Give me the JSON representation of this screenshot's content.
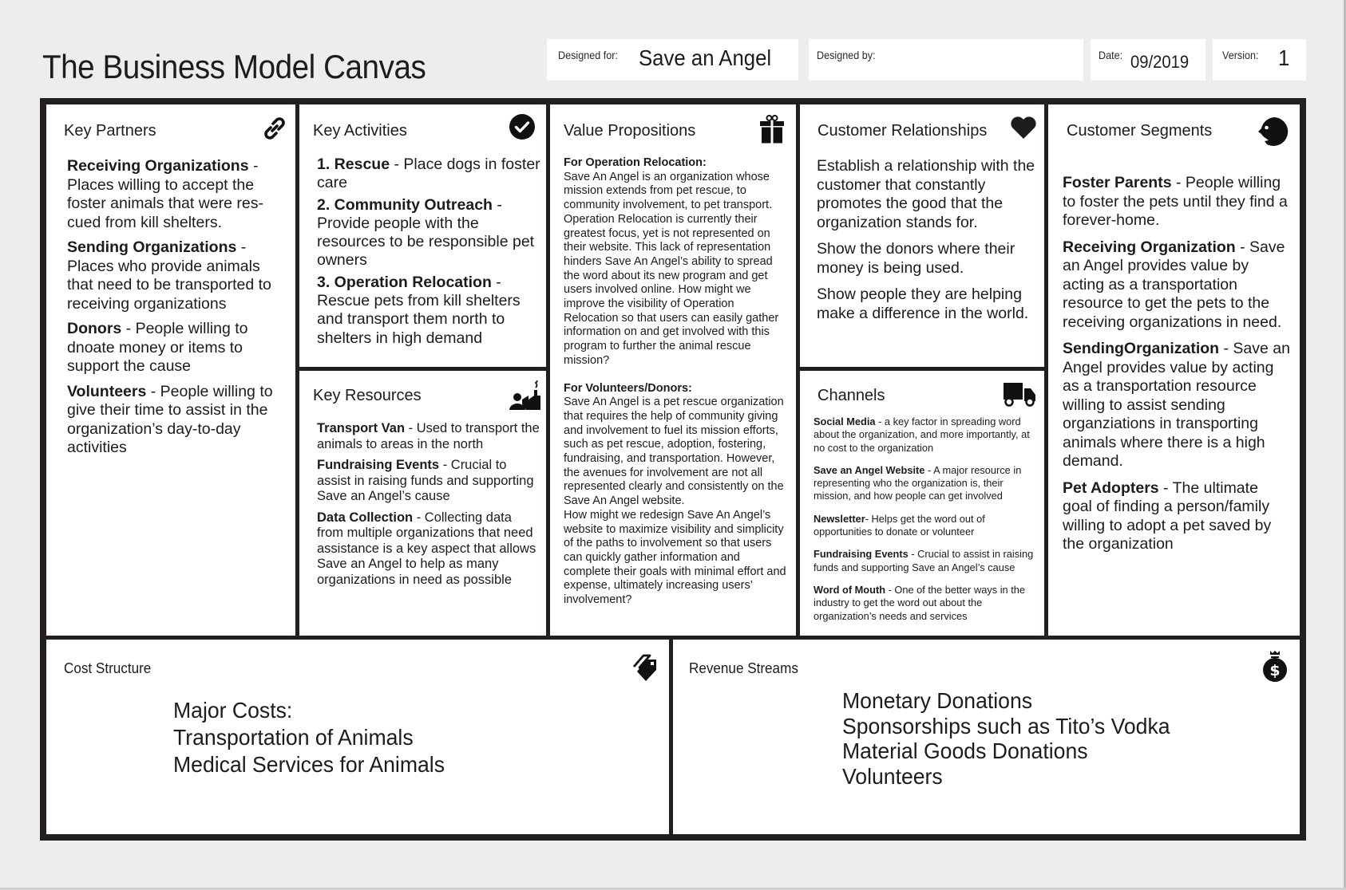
{
  "header": {
    "title": "The Business Model Canvas",
    "designed_for_label": "Designed for:",
    "designed_for_value": "Save an Angel",
    "designed_by_label": "Designed by:",
    "designed_by_value": "",
    "date_label": "Date:",
    "date_value": "09/2019",
    "version_label": "Version:",
    "version_value": "1"
  },
  "key_partners": {
    "title": "Key Partners",
    "icon": "link-icon",
    "items": [
      {
        "term": "Receiving Organizations",
        "desc": " - Places willing to accept the foster animals that were res­cued from kill shelters."
      },
      {
        "term": "Sending Organizations",
        "desc": " - Places who provide animals that need to be transported to receiving organizations"
      },
      {
        "term": "Donors",
        "desc": " - People willing to dnoate money or items to support the cause"
      },
      {
        "term": "Volunteers",
        "desc": " - People willing to give their time to assist in the organization’s day-to-day activities"
      }
    ]
  },
  "key_activities": {
    "title": "Key Activities",
    "icon": "check-circle-icon",
    "items": [
      {
        "term": "1. Rescue",
        "desc": " - Place dogs in foster care"
      },
      {
        "term": "2. Community Outreach",
        "desc": " - Provide people with the resources to be responsible pet owners"
      },
      {
        "term": "3. Operation Relocation",
        "desc": " - Rescue pets from kill shelters and transport them north to shelters in high demand"
      }
    ]
  },
  "key_resources": {
    "title": "Key Resources",
    "icon": "worker-factory-icon",
    "items": [
      {
        "term": "Transport Van",
        "desc": " - Used to transport the animals to areas in the north"
      },
      {
        "term": "Fundraising Events",
        "desc": " - Crucial to assist in raising funds and support­ing Save an Angel’s cause"
      },
      {
        "term": "Data Collection",
        "desc": " - Collecting data from multiple organizations that need assistance is a key aspect that allows Save an Angel to help as many organizations in need as possible"
      }
    ]
  },
  "value_propositions": {
    "title": "Value Propositions",
    "icon": "gift-icon",
    "sections": [
      {
        "heading": "For Operation Relocation:",
        "body": "Save An Angel is an organization whose mission extends from pet rescue, to community involvement, to pet trans­port. Operation Relocation is currently their greatest focus, yet is not represent­ed on their website. This lack of repre­sentation hinders Save An Angel’s ability to spread the word about its new program and get users involved online. How might we improve the visibility of Operation Relocation so that users can easily gather information on and get involved with this program to further the animal rescue mission?"
      },
      {
        "heading": "For Volunteers/Donors:",
        "body": "Save An Angel is a pet rescue organiza­tion that requires the help of community giving and involvement to fuel its mission efforts, such as pet rescue, adoption, fostering, fundraising, and transportation. However, the avenues for involvement are not all represented clearly and consistently on the Save An Angel website.",
        "body2": "How might we redesign Save An Angel’s website to maximize visibility and simplicity of the paths to involvement so that users can quickly gather informa­tion and complete their goals with minimal effort and expense, ultimately increasing users’ involvement?"
      }
    ]
  },
  "customer_relationships": {
    "title": "Customer Relationships",
    "icon": "heart-icon",
    "paragraphs": [
      "Establish a relationship with the customer that constantly promotes the good that the organization stands for.",
      "Show the  donors where their money is being used.",
      "Show people they are helping make a difference in the world."
    ]
  },
  "channels": {
    "title": "Channels",
    "icon": "truck-icon",
    "items": [
      {
        "term": "Social Media",
        "desc": " - a key factor in spreading word about the organization, and more importantly, at no cost to the organization"
      },
      {
        "term": "Save an Angel Website",
        "desc": " - A major resource in representing who the organization is, their mission, and how people can get involved"
      },
      {
        "term": "Newsletter",
        "desc": "- Helps get the word out of opportunities to donate or volunteer"
      },
      {
        "term": "Fundraising Events",
        "desc": " - Crucial to assist in raising funds and supporting Save an Angel’s cause"
      },
      {
        "term": "Word of Mouth",
        "desc": " - One of the better ways in the industry to get the word out about the organization’s needs and services"
      }
    ]
  },
  "customer_segments": {
    "title": "Customer Segments",
    "icon": "face-icon",
    "items": [
      {
        "term": "Foster Parents",
        "desc": " - People will­ing to foster the pets until they find a forever-home."
      },
      {
        "term": "Receiving Organization",
        "desc": " - Save an Angel provides value by acting as a transportation resource to get the pets to the receiving organizations in need."
      },
      {
        "term": "SendingOrganization",
        "desc": " - Save an Angel provides value by acting as a transportation resource willing to assist sending organziations in transporting animals where there is a high demand."
      },
      {
        "term": "Pet Adopters",
        "desc": " - The ultimate goal of finding a person/fami­ly willing to adopt a pet saved by the organization"
      }
    ]
  },
  "cost_structure": {
    "title": "Cost Structure",
    "icon": "price-tag-icon",
    "lines": [
      "Major Costs:",
      "Transportation of Animals",
      "Medical Services for Animals"
    ]
  },
  "revenue_streams": {
    "title": "Revenue Streams",
    "icon": "money-bag-icon",
    "lines": [
      "Monetary Donations",
      "Sponsorships such as Tito’s Vodka",
      "Material Goods Donations",
      "Volunteers"
    ]
  }
}
